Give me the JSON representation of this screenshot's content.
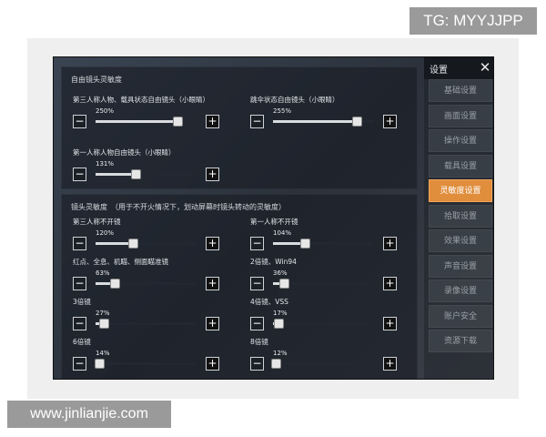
{
  "watermark_top": "TG: MYYJJPP",
  "watermark_bottom": "www.jinlianjie.com",
  "sidebar": {
    "title": "设置",
    "close_icon": "close-icon",
    "active_index": 4,
    "items": [
      "基础设置",
      "画面设置",
      "操作设置",
      "载具设置",
      "灵敏度设置",
      "拾取设置",
      "效果设置",
      "声音设置",
      "录像设置",
      "账户安全",
      "资源下载"
    ]
  },
  "free_look": {
    "title": "自由镜头灵敏度",
    "sliders": [
      {
        "label": "第三人称人物、载具状态自由镜头（小眼睛）",
        "value_text": "250%",
        "fraction": 0.82
      },
      {
        "label": "跳伞状态自由镜头（小眼睛）",
        "value_text": "255%",
        "fraction": 0.84
      },
      {
        "label": "第一人称人物自由镜头（小眼睛）",
        "value_text": "131%",
        "fraction": 0.4
      }
    ]
  },
  "scope": {
    "title": "镜头灵敏度　（用于不开火情况下，划动屏幕时镜头转动的灵敏度）",
    "sliders": [
      {
        "label": "第三人称不开镜",
        "value_text": "120%",
        "fraction": 0.37
      },
      {
        "label": "第一人称不开镜",
        "value_text": "104%",
        "fraction": 0.32
      },
      {
        "label": "红点、全息、机瞄、侧面瞄准镜",
        "value_text": "63%",
        "fraction": 0.19
      },
      {
        "label": "2倍镜、Win94",
        "value_text": "36%",
        "fraction": 0.11
      },
      {
        "label": "3倍镜",
        "value_text": "27%",
        "fraction": 0.08
      },
      {
        "label": "4倍镜、VSS",
        "value_text": "17%",
        "fraction": 0.05
      },
      {
        "label": "6倍镜",
        "value_text": "14%",
        "fraction": 0.04
      },
      {
        "label": "8倍镜",
        "value_text": "12%",
        "fraction": 0.03
      }
    ]
  },
  "controls": {
    "minus": "−",
    "plus": "+"
  }
}
